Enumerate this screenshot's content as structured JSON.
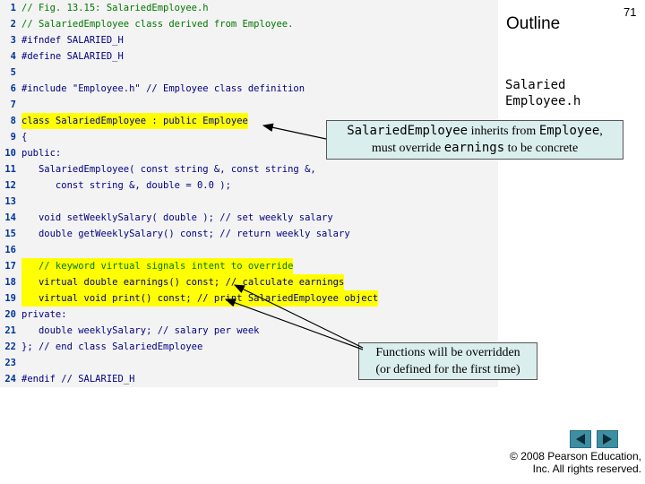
{
  "slide": {
    "outline_label": "Outline",
    "page_number": "71",
    "file_name_line1": "Salaried",
    "file_name_line2": "Employee.h"
  },
  "code_lines": [
    {
      "num": "1",
      "text": "// Fig. 13.15: SalariedEmployee.h"
    },
    {
      "num": "2",
      "text": "// SalariedEmployee class derived from Employee."
    },
    {
      "num": "3",
      "text": "#ifndef SALARIED_H"
    },
    {
      "num": "4",
      "text": "#define SALARIED_H"
    },
    {
      "num": "5",
      "text": ""
    },
    {
      "num": "6",
      "text": "#include \"Employee.h\" // Employee class definition"
    },
    {
      "num": "7",
      "text": ""
    },
    {
      "num": "8",
      "text": "class SalariedEmployee : public Employee"
    },
    {
      "num": "9",
      "text": "{"
    },
    {
      "num": "10",
      "text": "public:"
    },
    {
      "num": "11",
      "text": "   SalariedEmployee( const string &, const string &,"
    },
    {
      "num": "12",
      "text": "      const string &, double = 0.0 );"
    },
    {
      "num": "13",
      "text": ""
    },
    {
      "num": "14",
      "text": "   void setWeeklySalary( double ); // set weekly salary"
    },
    {
      "num": "15",
      "text": "   double getWeeklySalary() const; // return weekly salary"
    },
    {
      "num": "16",
      "text": ""
    },
    {
      "num": "17",
      "text": "   // keyword virtual signals intent to override"
    },
    {
      "num": "18",
      "text": "   virtual double earnings() const; // calculate earnings"
    },
    {
      "num": "19",
      "text": "   virtual void print() const; // print SalariedEmployee object"
    },
    {
      "num": "20",
      "text": "private:"
    },
    {
      "num": "21",
      "text": "   double weeklySalary; // salary per week"
    },
    {
      "num": "22",
      "text": "}; // end class SalariedEmployee"
    },
    {
      "num": "23",
      "text": ""
    },
    {
      "num": "24",
      "text": "#endif // SALARIED_H"
    }
  ],
  "callouts": {
    "inherit_part1": "SalariedEmployee",
    "inherit_part2": " inherits from ",
    "inherit_part3": "Employee",
    "inherit_part4": ",",
    "inherit_part5": "must override ",
    "inherit_part6": "earnings",
    "inherit_part7": " to be concrete",
    "override_line1": "Functions will be overridden",
    "override_line2": "(or defined for the first time)"
  },
  "copyright": {
    "line1": "© 2008 Pearson Education,",
    "line2": "Inc.  All rights reserved."
  },
  "colors": {
    "highlight": "#ffff00",
    "code_bg": "#f3f3f3",
    "callout_bg": "#dbeeee",
    "nav_button": "#3d8ea3"
  },
  "icons": {
    "prev": "triangle-left-icon",
    "next": "triangle-right-icon"
  }
}
